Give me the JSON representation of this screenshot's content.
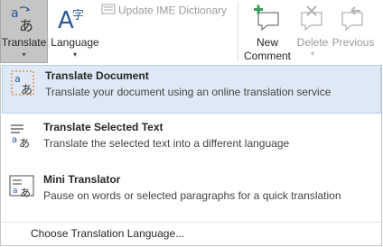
{
  "ribbon": {
    "translate": {
      "label": "Translate",
      "icon": "translate-icon"
    },
    "language": {
      "label": "Language",
      "icon": "language-icon"
    },
    "update_ime": {
      "label": "Update IME Dictionary",
      "icon": "ime-dictionary-icon",
      "enabled": false
    },
    "new_comment": {
      "label_line1": "New",
      "label_line2": "Comment",
      "icon": "new-comment-icon"
    },
    "delete": {
      "label": "Delete",
      "icon": "delete-comment-icon",
      "enabled": false
    },
    "previous": {
      "label": "Previous",
      "icon": "previous-comment-icon",
      "enabled": false
    }
  },
  "menu": {
    "items": [
      {
        "title": "Translate Document",
        "accelerator": "T",
        "description": "Translate your document using an online translation service",
        "icon": "translate-document-icon",
        "highlighted": true
      },
      {
        "title": "Translate Selected Text",
        "accelerator": "S",
        "description": "Translate the selected text into a different language",
        "icon": "translate-selected-text-icon",
        "highlighted": false
      },
      {
        "title": "Mini Translator",
        "accelerator": "M",
        "description": "Pause on words or selected paragraphs for a quick translation",
        "icon": "mini-translator-icon",
        "highlighted": false
      }
    ],
    "choose_language": "Choose Translation Language..."
  },
  "colors": {
    "pressed_button": "#c5c5c5",
    "highlight": "#dfe9f5",
    "highlight_border": "#b5cfea",
    "accent_blue": "#2b579a",
    "accent_orange": "#d4822b",
    "accent_green": "#3c9b5c",
    "disabled": "#9a9a9a"
  }
}
